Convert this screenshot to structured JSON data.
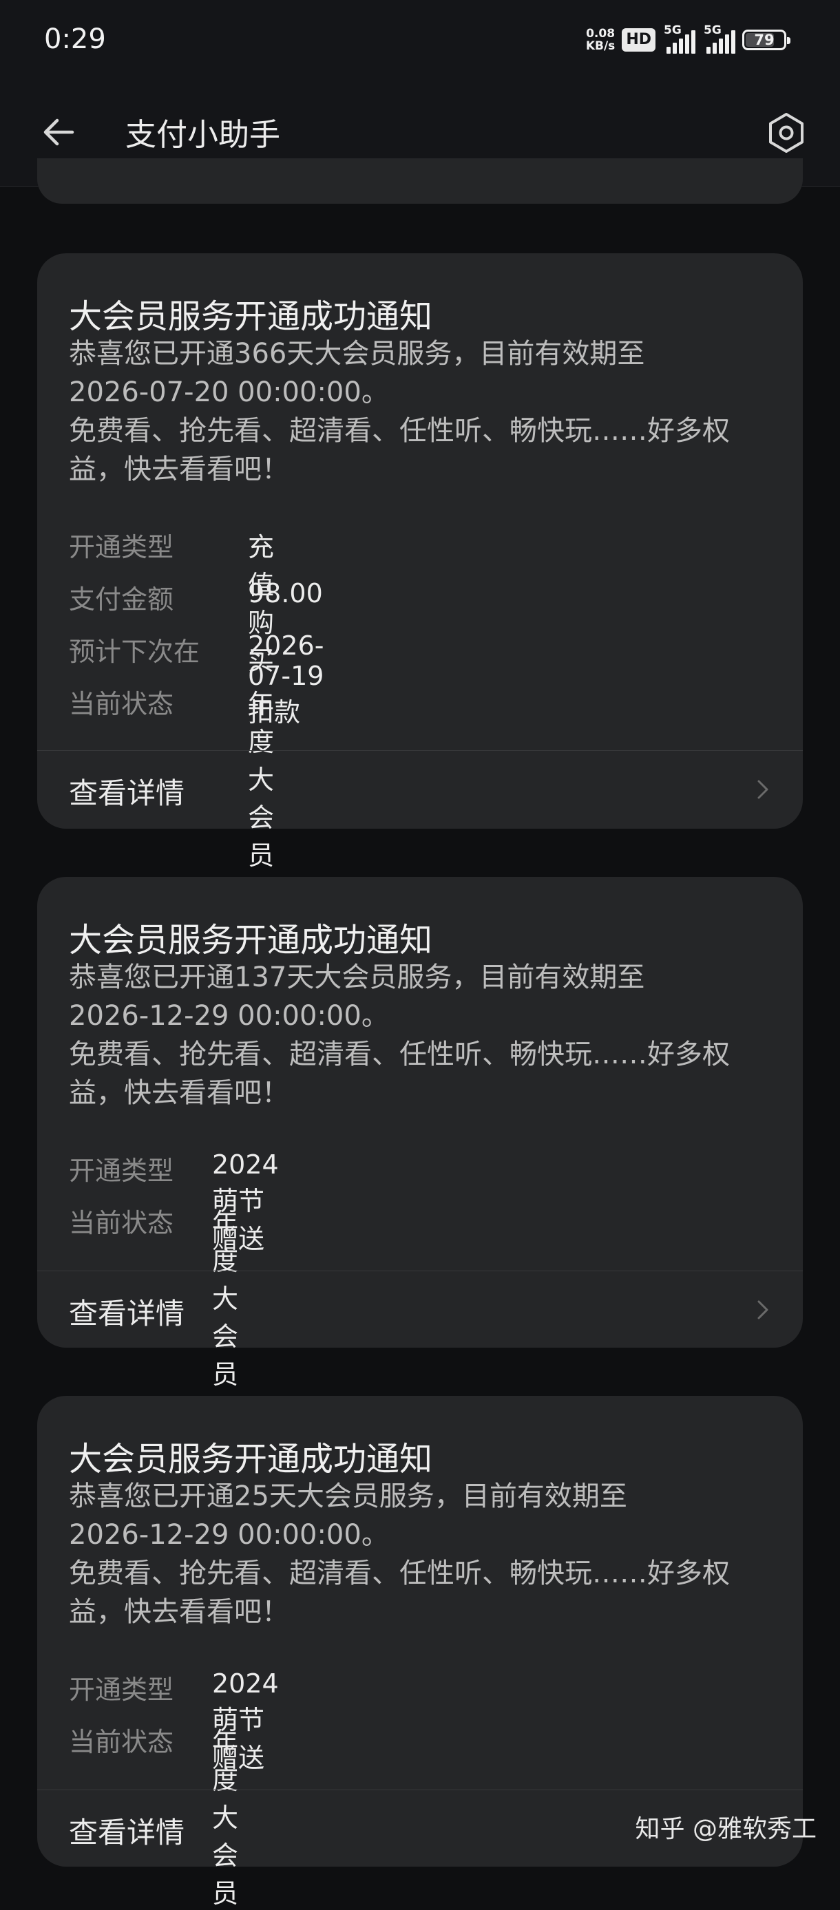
{
  "status_bar": {
    "time": "0:29",
    "net_speed_value": "0.08",
    "net_speed_unit": "KB/s",
    "hd_badge": "HD",
    "sim1_label": "5G",
    "sim2_label": "5G",
    "battery": "79"
  },
  "app_bar": {
    "title": "支付小助手",
    "back_icon": "arrow-left-icon",
    "settings_icon": "hexagon-settings-icon"
  },
  "cards": [
    {
      "title": "大会员服务开通成功通知",
      "body_line1": "恭喜您已开通366天大会员服务，目前有效期至",
      "body_line2": "2026-07-20 00:00:00。",
      "body_line3": "免费看、抢先看、超清看、任性听、畅快玩……好多权",
      "body_line4": "益，快去看看吧！",
      "fields": [
        {
          "label": "开通类型",
          "value": "充值购买"
        },
        {
          "label": "支付金额",
          "value": "98.00"
        },
        {
          "label": "预计下次在",
          "value": "2026-07-19扣款"
        },
        {
          "label": "当前状态",
          "value": "年度大会员"
        }
      ],
      "detail_label": "查看详情"
    },
    {
      "title": "大会员服务开通成功通知",
      "body_line1": "恭喜您已开通137天大会员服务，目前有效期至",
      "body_line2": "2026-12-29 00:00:00。",
      "body_line3": "免费看、抢先看、超清看、任性听、畅快玩……好多权",
      "body_line4": "益，快去看看吧！",
      "fields": [
        {
          "label": "开通类型",
          "value": "2024萌节赠送"
        },
        {
          "label": "当前状态",
          "value": "年度大会员"
        }
      ],
      "detail_label": "查看详情"
    },
    {
      "title": "大会员服务开通成功通知",
      "body_line1": "恭喜您已开通25天大会员服务，目前有效期至",
      "body_line2": "2026-12-29 00:00:00。",
      "body_line3": "免费看、抢先看、超清看、任性听、畅快玩……好多权",
      "body_line4": "益，快去看看吧！",
      "fields": [
        {
          "label": "开通类型",
          "value": "2024萌节赠送"
        },
        {
          "label": "当前状态",
          "value": "年度大会员"
        }
      ],
      "detail_label": "查看详情"
    }
  ],
  "watermark": "知乎 @雅软秀工",
  "colors": {
    "background": "#0e0f11",
    "card": "#252628",
    "label": "#8a8a8a",
    "text": "#ececec"
  }
}
